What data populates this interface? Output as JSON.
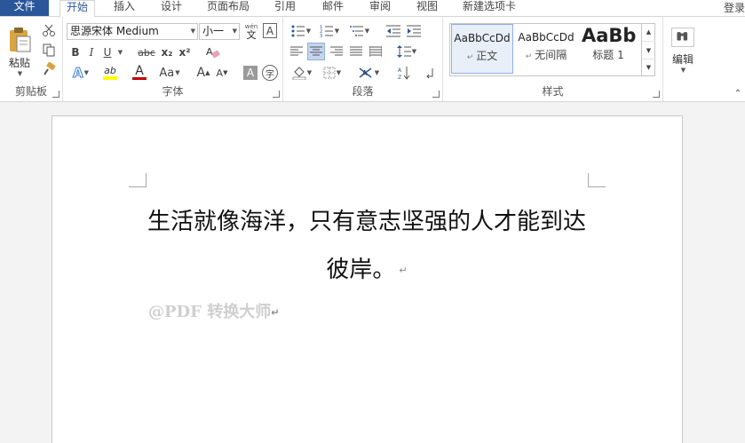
{
  "tabs": {
    "file": "文件",
    "home": "开始",
    "insert": "插入",
    "design": "设计",
    "layout": "页面布局",
    "references": "引用",
    "mailings": "邮件",
    "review": "审阅",
    "view": "视图",
    "new_tab": "新建选项卡",
    "login": "登录"
  },
  "clipboard": {
    "label": "剪贴板",
    "paste": "粘贴"
  },
  "font": {
    "label": "字体",
    "name": "思源宋体 Medium",
    "size": "小一",
    "wen_glyph": "wén",
    "wen_char": "文",
    "border_char": "A",
    "bold": "B",
    "italic": "I",
    "underline": "U",
    "strike": "abc",
    "subscript": "x₂",
    "superscript": "x²",
    "effect": "A",
    "highlight": "ab",
    "color": "A",
    "case": "Aa",
    "grow": "A",
    "shrink": "A",
    "shade_char": "A",
    "circle_char": "字"
  },
  "paragraph": {
    "label": "段落"
  },
  "styles": {
    "label": "样式",
    "items": [
      {
        "sample": "AaBbCcDd",
        "name": "正文"
      },
      {
        "sample": "AaBbCcDd",
        "name": "无间隔"
      },
      {
        "sample": "AaBb",
        "name": "标题 1"
      }
    ]
  },
  "editing": {
    "label": "编辑"
  },
  "document": {
    "line1": "生活就像海洋，只有意志坚强的人才能到达彼岸。",
    "watermark": "@PDF 转换大师",
    "para_mark": "↵"
  }
}
